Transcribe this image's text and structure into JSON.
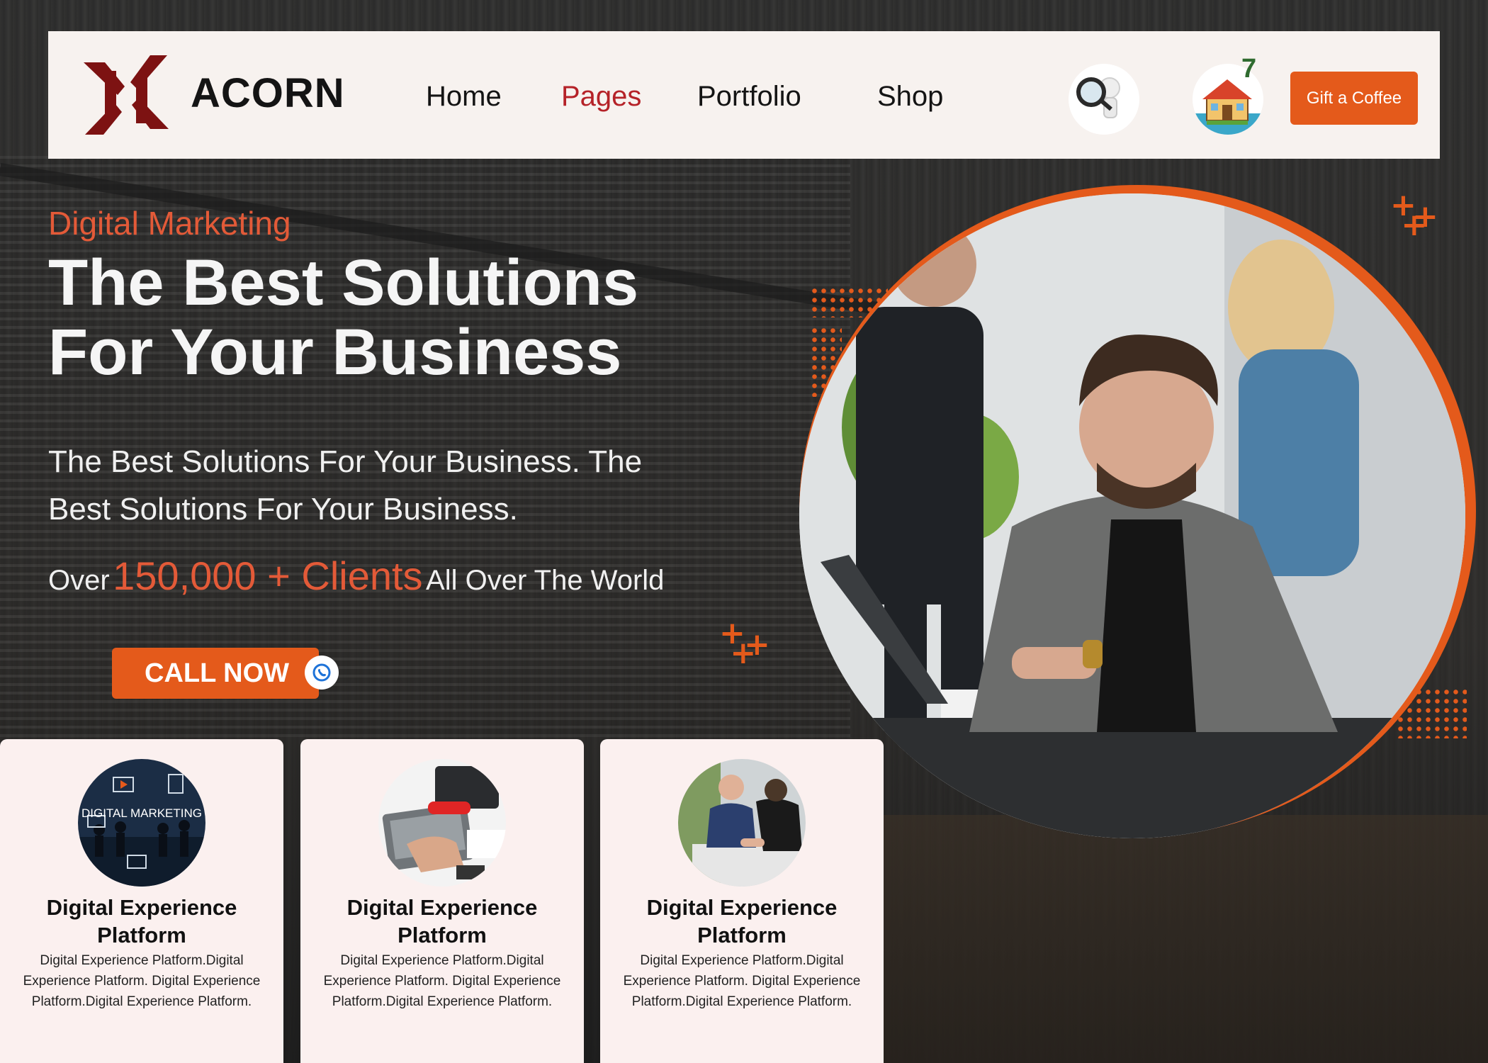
{
  "brand": {
    "name": "ACORN",
    "accent": "#e45a1b",
    "logo_color": "#7d1212"
  },
  "nav": {
    "items": [
      {
        "label": "Home"
      },
      {
        "label": "Pages"
      },
      {
        "label": "Portfolio"
      },
      {
        "label": "Shop"
      }
    ],
    "active": "Pages",
    "search_icon": "magnifier-figure-icon",
    "home_icon": "house-icon",
    "home_badge": "7",
    "cta_label": "Gift a Coffee"
  },
  "hero": {
    "eyebrow": "Digital Marketing",
    "headline_line1": "The Best Solutions",
    "headline_line2": "For Your Business",
    "subtext": "The Best Solutions For Your Business. The Best Solutions For Your Business.",
    "clients_prefix": "Over",
    "clients_highlight": "150,000 + Clients",
    "clients_suffix": "All Over The World",
    "call_label": "CALL NOW",
    "call_icon": "phone-icon"
  },
  "cards": [
    {
      "image_caption": "DIGITAL MARKETING",
      "title": "Digital Experience Platform",
      "body": "Digital Experience Platform.Digital Experience Platform. Digital Experience Platform.Digital Experience Platform."
    },
    {
      "title": "Digital Experience Platform",
      "body": "Digital Experience Platform.Digital Experience Platform. Digital Experience Platform.Digital Experience Platform."
    },
    {
      "title": "Digital Experience Platform",
      "body": "Digital Experience Platform.Digital Experience Platform. Digital Experience Platform.Digital Experience Platform."
    }
  ]
}
